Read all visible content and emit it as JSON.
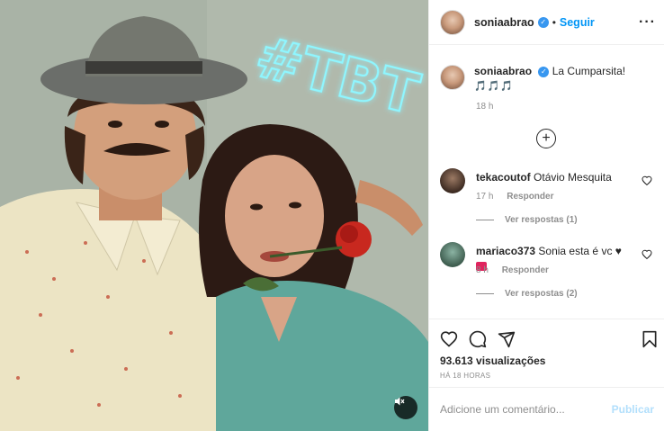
{
  "post": {
    "overlay_text": "#TBT",
    "mute_icon": "speaker-muted-icon"
  },
  "header": {
    "username": "soniaabrao",
    "separator": "•",
    "follow_label": "Seguir",
    "more_label": "···"
  },
  "caption": {
    "username": "soniaabrao",
    "text": "La Cumparsita!",
    "emojis": "🎵🎵🎵",
    "time": "18 h"
  },
  "comments": [
    {
      "username": "tekacoutof",
      "text": "Otávio Mesquita",
      "time": "17 h",
      "reply_label": "Responder",
      "view_replies": "Ver respostas (1)"
    },
    {
      "username": "mariaco373",
      "text": "Sonia esta é vc ♥",
      "time": "8 h",
      "reply_label": "Responder",
      "view_replies": "Ver respostas (2)"
    }
  ],
  "stats": {
    "views": "93.613 visualizações",
    "time_ago": "HÁ 18 HORAS"
  },
  "composer": {
    "placeholder": "Adicione um comentário...",
    "publish_label": "Publicar"
  },
  "colors": {
    "accent": "#0095f6",
    "verified": "#3897f0",
    "neon": "#7ff3ff"
  }
}
